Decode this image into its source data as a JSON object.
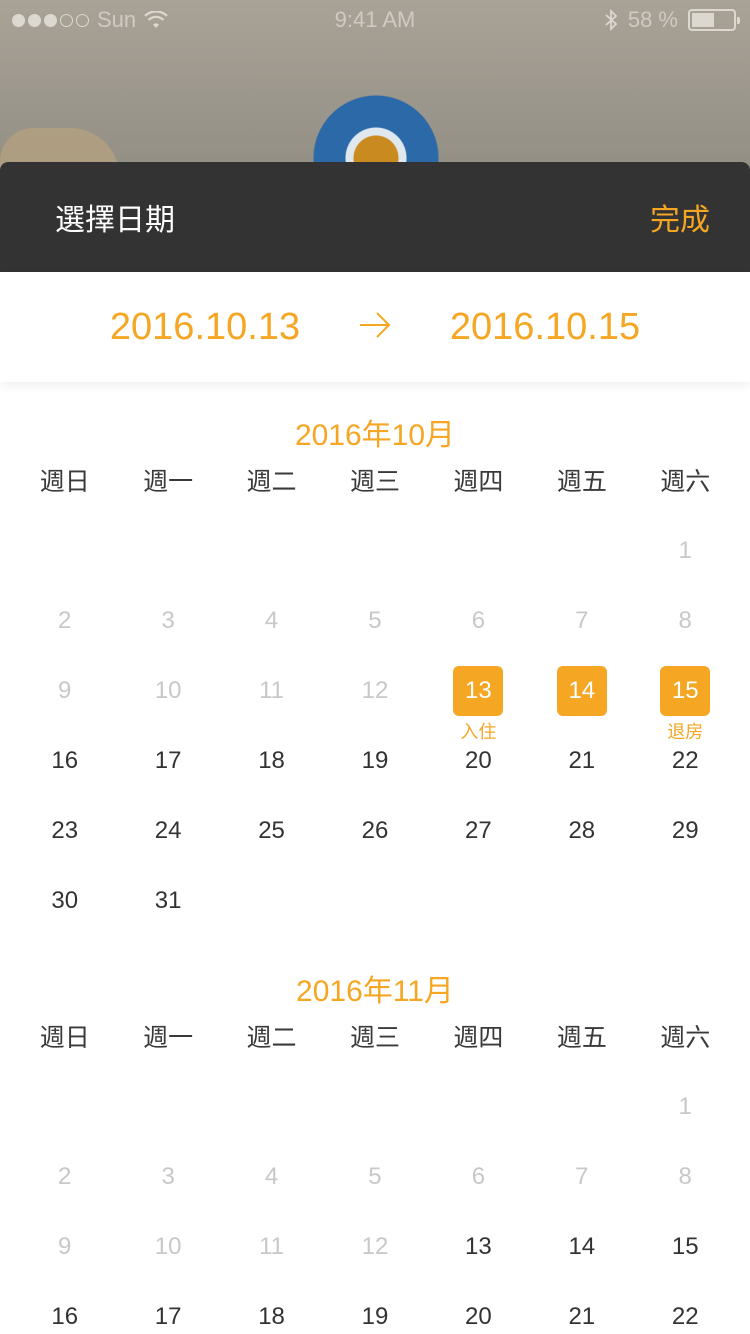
{
  "status_bar": {
    "carrier": "Sun",
    "time": "9:41 AM",
    "battery": "58 %"
  },
  "sheet": {
    "title": "選擇日期",
    "done_label": "完成"
  },
  "range": {
    "checkin": "2016.10.13",
    "checkout": "2016.10.15"
  },
  "weekday_labels": [
    "週日",
    "週一",
    "週二",
    "週三",
    "週四",
    "週五",
    "週六"
  ],
  "months": [
    {
      "title": "2016年10月",
      "weeks": [
        [
          null,
          null,
          null,
          null,
          null,
          null,
          {
            "d": "1",
            "s": "past"
          }
        ],
        [
          {
            "d": "2",
            "s": "past"
          },
          {
            "d": "3",
            "s": "past"
          },
          {
            "d": "4",
            "s": "past"
          },
          {
            "d": "5",
            "s": "past"
          },
          {
            "d": "6",
            "s": "past"
          },
          {
            "d": "7",
            "s": "past"
          },
          {
            "d": "8",
            "s": "past"
          }
        ],
        [
          {
            "d": "9",
            "s": "past"
          },
          {
            "d": "10",
            "s": "past"
          },
          {
            "d": "11",
            "s": "past"
          },
          {
            "d": "12",
            "s": "past"
          },
          {
            "d": "13",
            "s": "sel",
            "tag": "入住"
          },
          {
            "d": "14",
            "s": "sel"
          },
          {
            "d": "15",
            "s": "sel",
            "tag": "退房"
          }
        ],
        [
          {
            "d": "16"
          },
          {
            "d": "17"
          },
          {
            "d": "18"
          },
          {
            "d": "19"
          },
          {
            "d": "20"
          },
          {
            "d": "21"
          },
          {
            "d": "22"
          }
        ],
        [
          {
            "d": "23"
          },
          {
            "d": "24"
          },
          {
            "d": "25"
          },
          {
            "d": "26"
          },
          {
            "d": "27"
          },
          {
            "d": "28"
          },
          {
            "d": "29"
          }
        ],
        [
          {
            "d": "30"
          },
          {
            "d": "31"
          },
          null,
          null,
          null,
          null,
          null
        ]
      ]
    },
    {
      "title": "2016年11月",
      "weeks": [
        [
          null,
          null,
          null,
          null,
          null,
          null,
          {
            "d": "1",
            "s": "past"
          }
        ],
        [
          {
            "d": "2",
            "s": "past"
          },
          {
            "d": "3",
            "s": "past"
          },
          {
            "d": "4",
            "s": "past"
          },
          {
            "d": "5",
            "s": "past"
          },
          {
            "d": "6",
            "s": "past"
          },
          {
            "d": "7",
            "s": "past"
          },
          {
            "d": "8",
            "s": "past"
          }
        ],
        [
          {
            "d": "9",
            "s": "past"
          },
          {
            "d": "10",
            "s": "past"
          },
          {
            "d": "11",
            "s": "past"
          },
          {
            "d": "12",
            "s": "past"
          },
          {
            "d": "13"
          },
          {
            "d": "14"
          },
          {
            "d": "15"
          }
        ],
        [
          {
            "d": "16"
          },
          {
            "d": "17"
          },
          {
            "d": "18"
          },
          {
            "d": "19"
          },
          {
            "d": "20"
          },
          {
            "d": "21"
          },
          {
            "d": "22"
          }
        ]
      ]
    }
  ],
  "colors": {
    "accent": "#f5a623",
    "header_bg": "#333333",
    "past_text": "#c8c8c8"
  },
  "icons": [
    "wifi-icon",
    "bluetooth-icon",
    "battery-icon",
    "arrow-right-icon"
  ]
}
